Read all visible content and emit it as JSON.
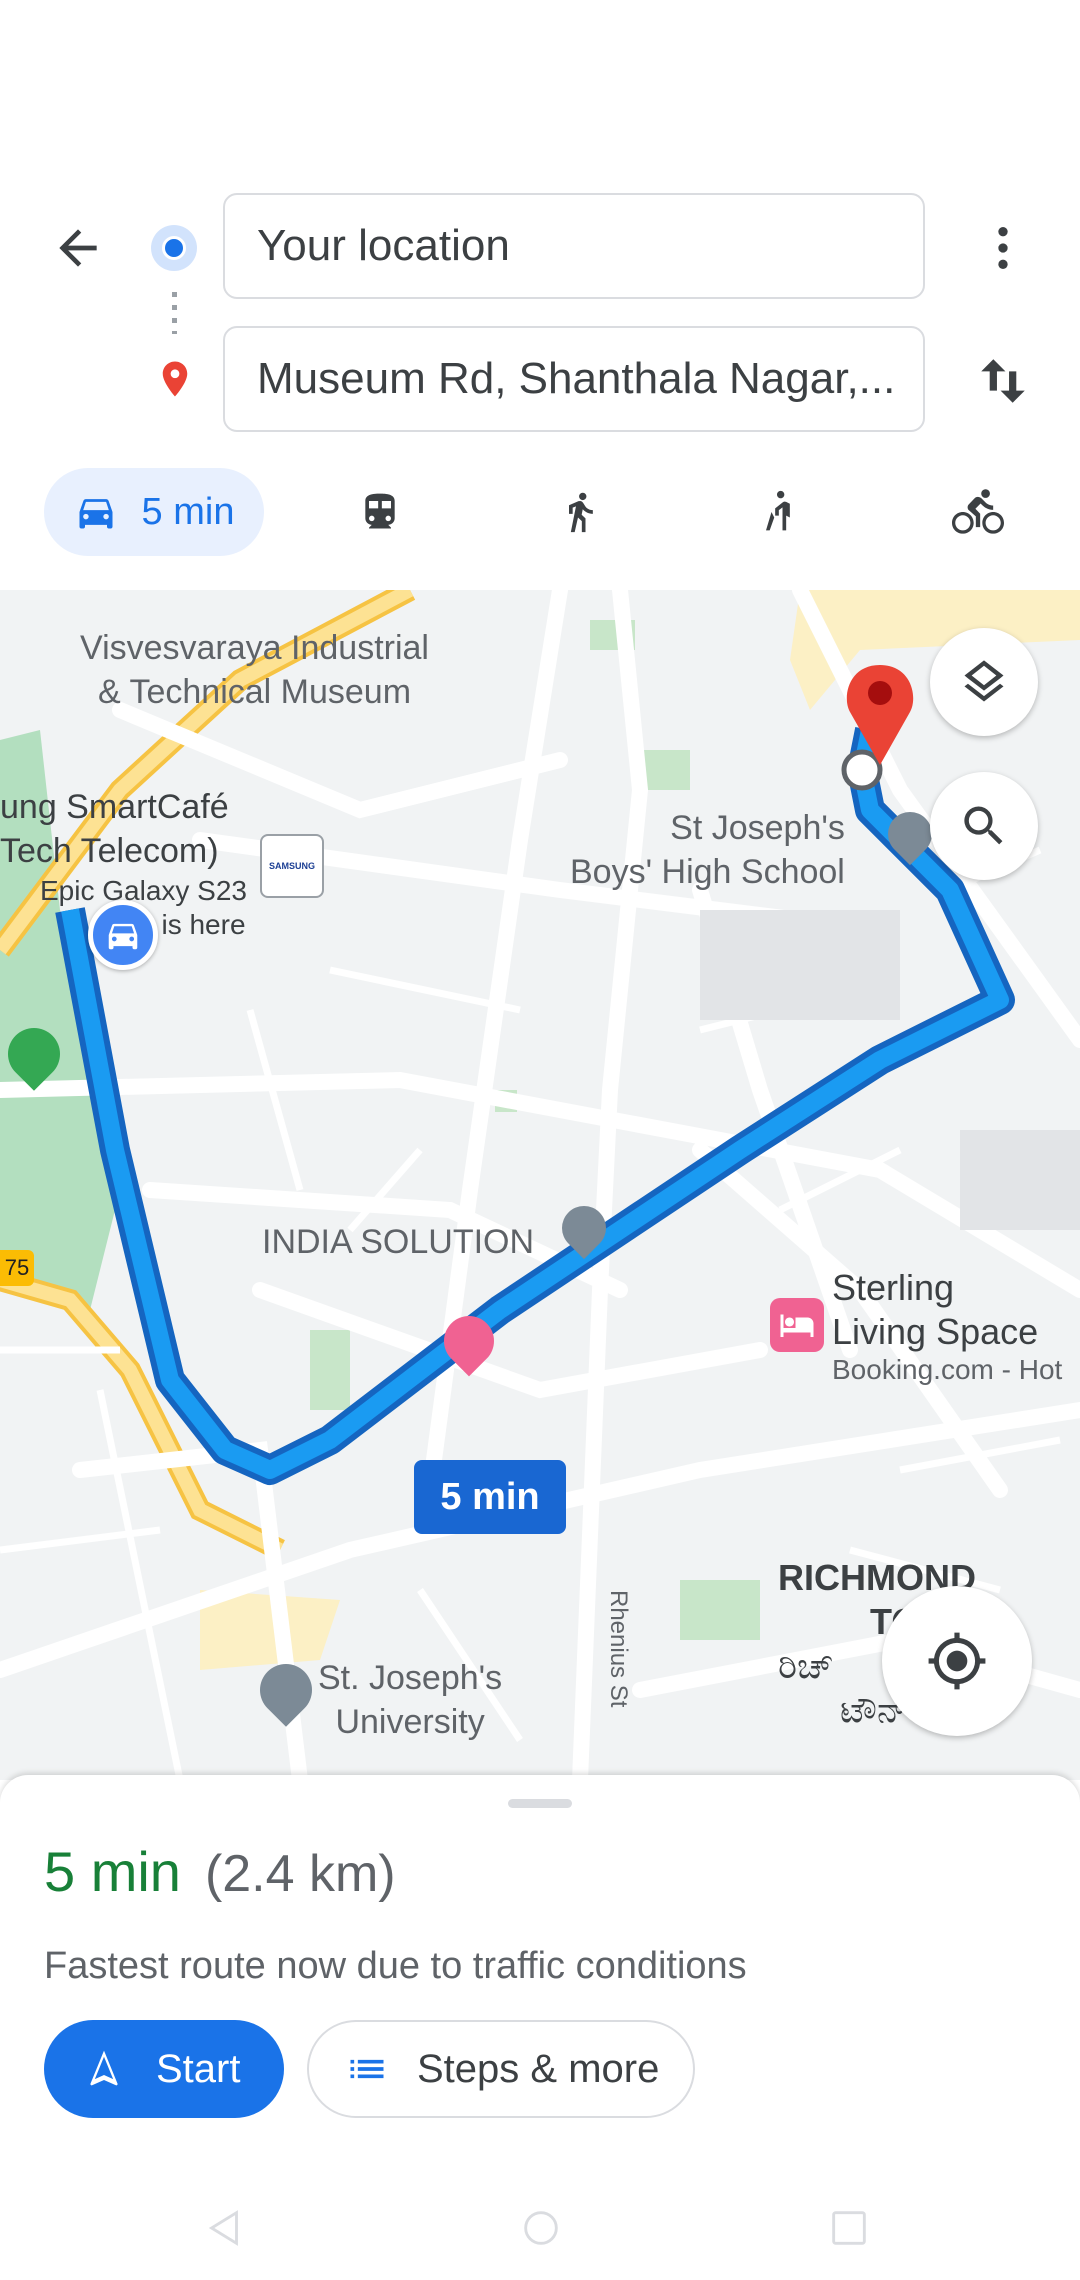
{
  "search": {
    "origin_value": "Your location",
    "destination_value": "Museum Rd, Shanthala Nagar,..."
  },
  "modes": {
    "drive_label": "5 min"
  },
  "map": {
    "labels": {
      "museum_line1": "Visvesvaraya Industrial",
      "museum_line2": "& Technical Museum",
      "cafe_line1": "ung SmartCafé",
      "cafe_line2": "Tech Telecom)",
      "galaxy_line1": "Epic Galaxy S23",
      "galaxy_line2": "is here",
      "samsung_logo": "SAMSUNG",
      "stjoseph_line1": "St Joseph's",
      "stjoseph_line2": "Boys' High School",
      "india_solution": "INDIA SOLUTION",
      "sterling_line1": "Sterling",
      "sterling_line2": "Living Space",
      "sterling_line3": "Booking.com - Hot",
      "route_time": "5 min",
      "rhenius": "Rhenius St",
      "richmond_line1": "RICHMOND",
      "richmond_line2": "TO",
      "richmond_kn1": "ರಿಚ್",
      "richmond_kn2": "ಟೌನ್",
      "university_line1": "St. Joseph's",
      "university_line2": "University",
      "road_badge": "75"
    }
  },
  "route": {
    "duration": "5 min",
    "distance": "(2.4 km)",
    "note": "Fastest route now due to traffic conditions",
    "start_label": "Start",
    "steps_label": "Steps & more"
  },
  "colors": {
    "accent": "#1a73e8",
    "route": "#1a9bf2",
    "route_outline": "#1565c0",
    "duration_green": "#188038",
    "pin_red": "#ea4335",
    "mode_selected_bg": "#e8f0fe"
  }
}
